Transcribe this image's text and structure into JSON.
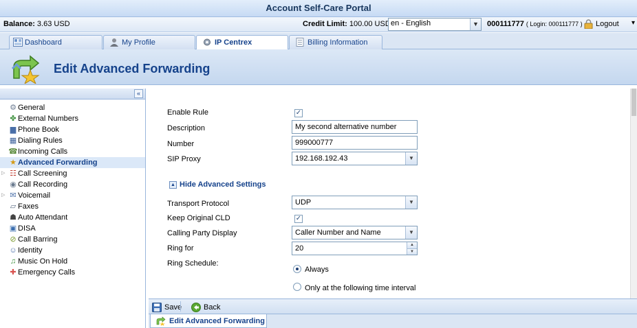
{
  "app": {
    "title": "Account Self-Care Portal"
  },
  "infobar": {
    "balance_label": "Balance:",
    "balance_value": "3.63 USD",
    "credit_label": "Credit Limit:",
    "credit_value": "100.00 USD",
    "language": "en - English",
    "account_id": "000111777",
    "account_login": "( Login: 000111777 )",
    "logout_label": "Logout"
  },
  "tabs": [
    {
      "label": "Dashboard",
      "icon": "dashboard-icon"
    },
    {
      "label": "My Profile",
      "icon": "profile-icon"
    },
    {
      "label": "IP Centrex",
      "icon": "gear-icon",
      "active": true
    },
    {
      "label": "Billing Information",
      "icon": "document-icon"
    }
  ],
  "page": {
    "title": "Edit Advanced Forwarding",
    "icon": "advanced-forwarding-icon"
  },
  "sidebar": {
    "items": [
      {
        "label": "General",
        "icon": "gear-icon"
      },
      {
        "label": "External Numbers",
        "icon": "external-numbers-icon"
      },
      {
        "label": "Phone Book",
        "icon": "phone-book-icon"
      },
      {
        "label": "Dialing Rules",
        "icon": "dialing-rules-icon"
      },
      {
        "label": "Incoming Calls",
        "icon": "incoming-calls-icon"
      },
      {
        "label": "Advanced Forwarding",
        "icon": "forwarding-icon",
        "active": true
      },
      {
        "label": "Call Screening",
        "icon": "call-screening-icon",
        "expandable": true
      },
      {
        "label": "Call Recording",
        "icon": "call-recording-icon"
      },
      {
        "label": "Voicemail",
        "icon": "voicemail-icon",
        "expandable": true
      },
      {
        "label": "Faxes",
        "icon": "fax-icon"
      },
      {
        "label": "Auto Attendant",
        "icon": "auto-attendant-icon"
      },
      {
        "label": "DISA",
        "icon": "disa-icon"
      },
      {
        "label": "Call Barring",
        "icon": "call-barring-icon"
      },
      {
        "label": "Identity",
        "icon": "identity-icon"
      },
      {
        "label": "Music On Hold",
        "icon": "music-icon"
      },
      {
        "label": "Emergency Calls",
        "icon": "emergency-icon"
      }
    ]
  },
  "form": {
    "enable_rule": {
      "label": "Enable Rule",
      "checked": true
    },
    "description": {
      "label": "Description",
      "value": "My second alternative number"
    },
    "number": {
      "label": "Number",
      "value": "999000777"
    },
    "sip_proxy": {
      "label": "SIP Proxy",
      "value": "192.168.192.43"
    },
    "advanced_toggle": "Hide Advanced Settings",
    "transport_protocol": {
      "label": "Transport Protocol",
      "value": "UDP"
    },
    "keep_original_cld": {
      "label": "Keep Original CLD",
      "checked": true
    },
    "calling_party_display": {
      "label": "Calling Party Display",
      "value": "Caller Number and Name"
    },
    "ring_for": {
      "label": "Ring for",
      "value": "20"
    },
    "ring_schedule": {
      "label": "Ring Schedule:",
      "options": [
        "Always",
        "Only at the following time interval"
      ],
      "selected": "Always"
    }
  },
  "toolbar": {
    "save_label": "Save",
    "back_label": "Back"
  },
  "bottom_tab": {
    "label": "Edit Advanced Forwarding"
  },
  "colors": {
    "accent": "#15428b",
    "header_bg": "#c6daf4",
    "active_item_bg": "#dbe8f8"
  }
}
